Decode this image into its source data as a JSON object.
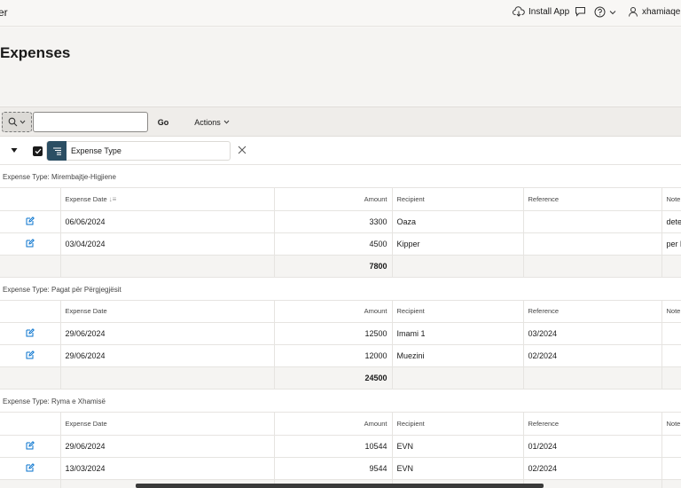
{
  "header": {
    "app_name_fragment": "er",
    "install_label": "Install App",
    "username": "xhamiaqen"
  },
  "page": {
    "title": "Expenses"
  },
  "toolbar": {
    "search_value": "",
    "go_label": "Go",
    "actions_label": "Actions"
  },
  "control_break": {
    "label": "Expense Type",
    "checked": true
  },
  "columns": {
    "date": "Expense Date",
    "amount": "Amount",
    "recipient": "Recipient",
    "reference": "Reference",
    "notes": "Note"
  },
  "groups": [
    {
      "label": "Expense Type: Mirembajtje-Higjiene",
      "rows": [
        {
          "date": "06/06/2024",
          "amount": "3300",
          "recipient": "Oaza",
          "reference": "",
          "notes": "dete"
        },
        {
          "date": "03/04/2024",
          "amount": "4500",
          "recipient": "Kipper",
          "reference": "",
          "notes": "per k"
        }
      ],
      "total": "7800"
    },
    {
      "label": "Expense Type: Pagat për Përgjegjësit",
      "rows": [
        {
          "date": "29/06/2024",
          "amount": "12500",
          "recipient": "Imami 1",
          "reference": "03/2024",
          "notes": ""
        },
        {
          "date": "29/06/2024",
          "amount": "12000",
          "recipient": "Muezini",
          "reference": "02/2024",
          "notes": ""
        }
      ],
      "total": "24500"
    },
    {
      "label": "Expense Type: Ryma e Xhamisë",
      "rows": [
        {
          "date": "29/06/2024",
          "amount": "10544",
          "recipient": "EVN",
          "reference": "01/2024",
          "notes": ""
        },
        {
          "date": "13/03/2024",
          "amount": "9544",
          "recipient": "EVN",
          "reference": "02/2024",
          "notes": ""
        }
      ],
      "total": ""
    }
  ],
  "colors": {
    "accent": "#2b4e63",
    "link": "#0572ce",
    "background": "#f8f7f5"
  },
  "icons": {
    "install": "cloud-download-icon",
    "chat": "chat-bubble-icon",
    "help": "help-icon",
    "user": "user-icon",
    "search": "search-icon",
    "edit": "edit-icon",
    "close": "close-icon"
  }
}
